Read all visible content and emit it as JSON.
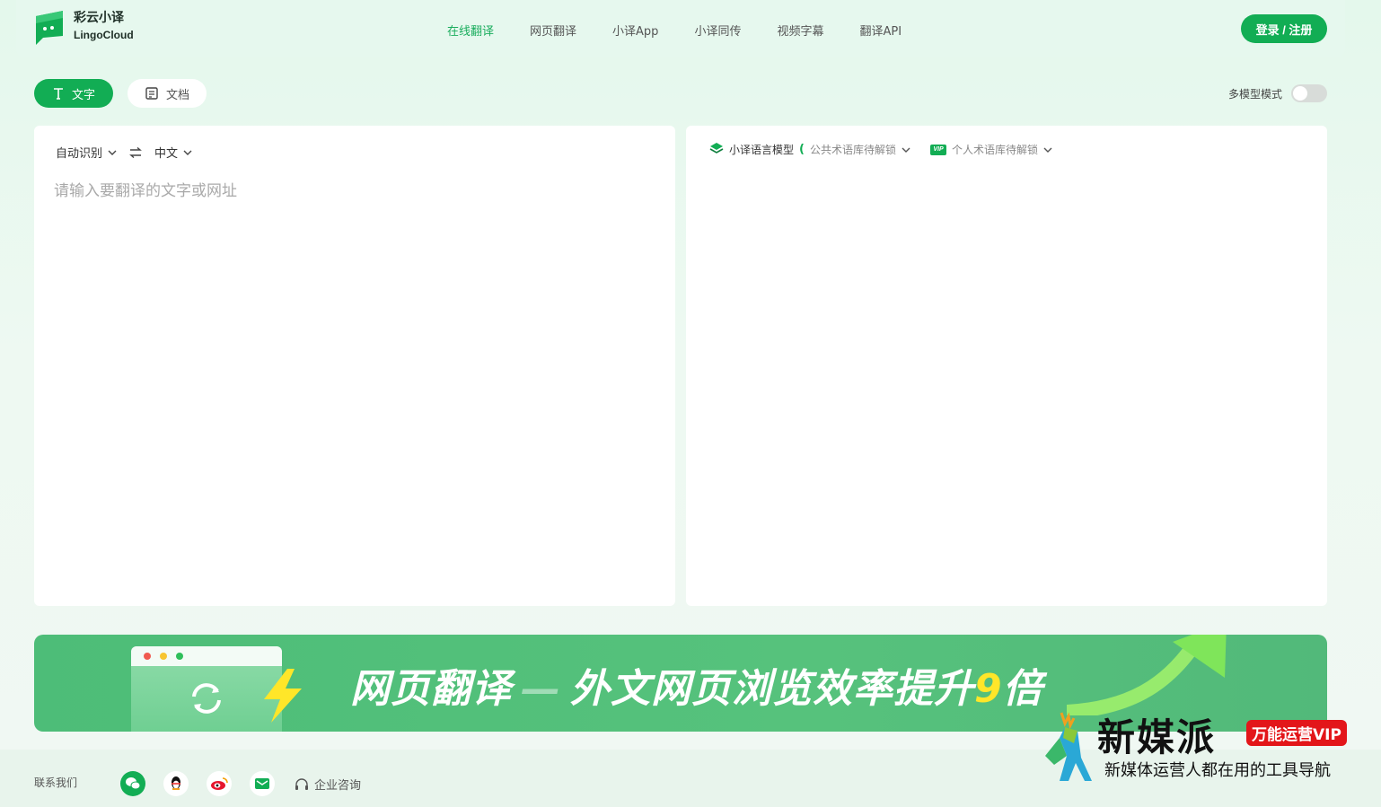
{
  "brand": {
    "name_cn": "彩云小译",
    "name_en": "LingoCloud",
    "color": "#12ad54"
  },
  "nav": {
    "items": [
      {
        "label": "在线翻译",
        "active": true
      },
      {
        "label": "网页翻译"
      },
      {
        "label": "小译App"
      },
      {
        "label": "小译同传"
      },
      {
        "label": "视频字幕"
      },
      {
        "label": "翻译API"
      }
    ],
    "login_label": "登录 / 注册"
  },
  "mode_tabs": {
    "text_label": "文字",
    "doc_label": "文档",
    "active": "text"
  },
  "multi_model": {
    "label": "多模型模式",
    "enabled": false
  },
  "source": {
    "source_lang": "自动识别",
    "target_lang": "中文",
    "placeholder": "请输入要翻译的文字或网址"
  },
  "target": {
    "model_label": "小译语言模型",
    "public_term": "公共术语库待解锁",
    "vip_badge": "VIP",
    "personal_term": "个人术语库待解锁"
  },
  "banner": {
    "title_part1": "网页翻译",
    "title_part2": "外文网页浏览效率提升",
    "highlight": "9",
    "title_part3": "倍"
  },
  "footer": {
    "contact_label": "联系我们",
    "consult_label": "企业咨询"
  },
  "watermark": {
    "title": "新媒派",
    "badge": "万能运营VIP",
    "subtitle": "新媒体运营人都在用的工具导航"
  }
}
